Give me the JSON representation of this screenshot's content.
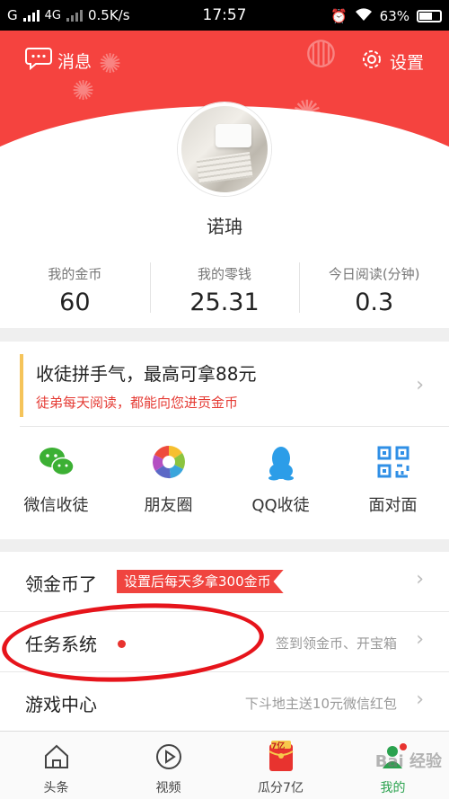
{
  "status_bar": {
    "carrier_left": "G",
    "network": "4G",
    "speed": "0.5K/s",
    "time": "17:57",
    "battery": "63%"
  },
  "header": {
    "messages_label": "消息",
    "settings_label": "设置",
    "accent_color": "#f5433f"
  },
  "profile": {
    "username": "诺珃"
  },
  "stats": [
    {
      "label": "我的金币",
      "value": "60"
    },
    {
      "label": "我的零钱",
      "value": "25.31"
    },
    {
      "label": "今日阅读(分钟)",
      "value": "0.3"
    }
  ],
  "recruit": {
    "title": "收徒拼手气，最高可拿88元",
    "subtitle": "徒弟每天阅读，都能向您进贡金币",
    "share_options": [
      {
        "label": "微信收徒",
        "icon": "wechat-icon"
      },
      {
        "label": "朋友圈",
        "icon": "moments-icon"
      },
      {
        "label": "QQ收徒",
        "icon": "qq-icon"
      },
      {
        "label": "面对面",
        "icon": "qrcode-icon"
      }
    ]
  },
  "list": {
    "coins": {
      "title": "领金币了",
      "tag": "设置后每天多拿300金币"
    },
    "tasks": {
      "title": "任务系统",
      "detail": "签到领金币、开宝箱"
    },
    "games": {
      "title": "游戏中心",
      "detail": "下斗地主送10元微信红包"
    }
  },
  "tabbar": [
    {
      "label": "头条",
      "icon": "home-icon"
    },
    {
      "label": "视频",
      "icon": "play-icon"
    },
    {
      "label": "瓜分7亿",
      "icon": "red-envelope-icon",
      "badge": "7亿"
    },
    {
      "label": "我的",
      "icon": "profile-icon",
      "active": true
    }
  ],
  "watermark": "Bai 经验"
}
